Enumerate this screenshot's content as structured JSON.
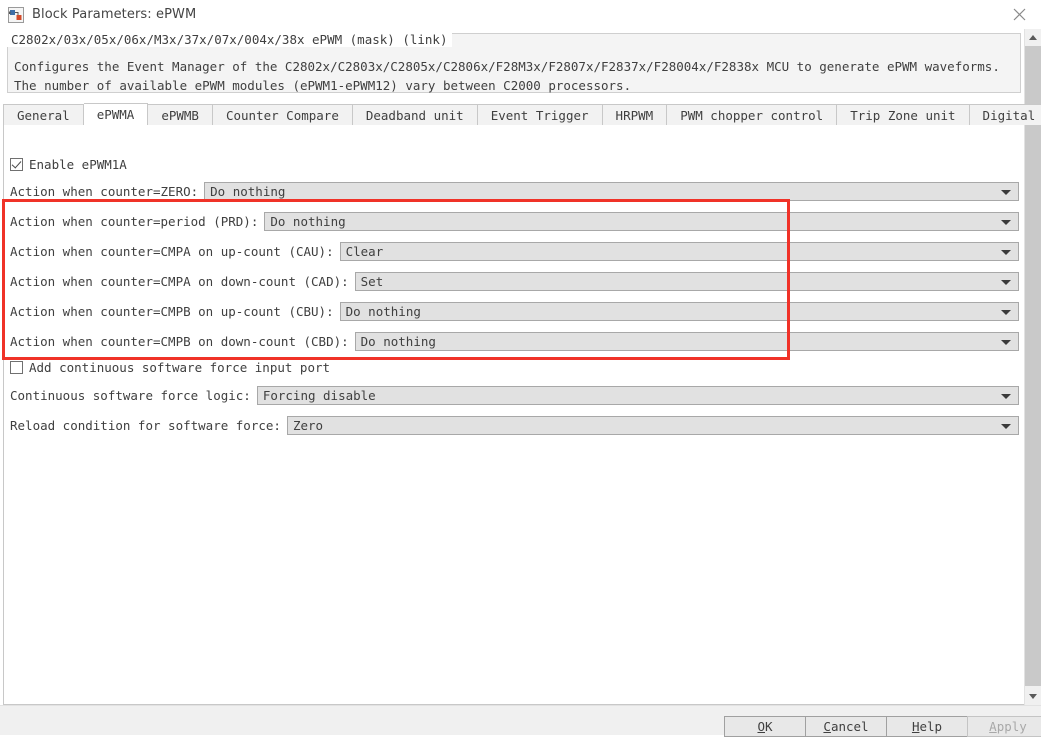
{
  "window": {
    "title": "Block Parameters: ePWM",
    "icon": "simulink-block-icon",
    "close_icon": "close-icon"
  },
  "mask": {
    "caption": "C2802x/03x/05x/06x/M3x/37x/07x/004x/38x ePWM (mask) (link)",
    "description_line1": "Configures the Event Manager of the C2802x/C2803x/C2805x/C2806x/F28M3x/F2807x/F2837x/F28004x/F2838x MCU to generate ePWM waveforms.",
    "description_line2": "The number of available ePWM modules (ePWM1-ePWM12) vary between C2000 processors."
  },
  "tabs": [
    {
      "label": "General",
      "selected": false
    },
    {
      "label": "ePWMA",
      "selected": true
    },
    {
      "label": "ePWMB",
      "selected": false
    },
    {
      "label": "Counter Compare",
      "selected": false
    },
    {
      "label": "Deadband unit",
      "selected": false
    },
    {
      "label": "Event Trigger",
      "selected": false
    },
    {
      "label": "HRPWM",
      "selected": false
    },
    {
      "label": "PWM chopper control",
      "selected": false
    },
    {
      "label": "Trip Zone unit",
      "selected": false
    },
    {
      "label": "Digital Compare",
      "selected": false
    }
  ],
  "form": {
    "enable_epwm1a": {
      "label": "Enable ePWM1A",
      "checked": true
    },
    "add_sw_force_port": {
      "label": "Add continuous software force input port",
      "checked": false
    },
    "fields": [
      {
        "label": "Action when counter=ZERO:",
        "value": "Do nothing"
      },
      {
        "label": "Action when counter=period (PRD):",
        "value": "Do nothing"
      },
      {
        "label": "Action when counter=CMPA on up-count (CAU):",
        "value": "Clear"
      },
      {
        "label": "Action when counter=CMPA on down-count (CAD):",
        "value": "Set"
      },
      {
        "label": "Action when counter=CMPB on up-count (CBU):",
        "value": "Do nothing"
      },
      {
        "label": "Action when counter=CMPB on down-count (CBD):",
        "value": "Do nothing"
      },
      {
        "label": "Continuous software force logic:",
        "value": "Forcing disable"
      },
      {
        "label": "Reload condition for software force:",
        "value": "Zero"
      }
    ]
  },
  "annotation": {
    "color": "#f03228",
    "name": "red-highlight-rectangle"
  },
  "scrollbar": {
    "up_icon": "chevron-up-icon",
    "down_icon": "chevron-down-icon"
  },
  "footer": {
    "ok": "OK",
    "cancel": "Cancel",
    "help": "Help",
    "apply": "Apply",
    "apply_enabled": false
  }
}
